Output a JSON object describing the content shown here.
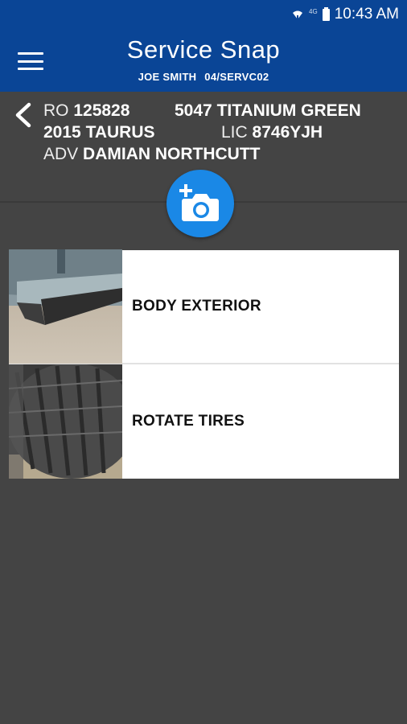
{
  "status_bar": {
    "network_label": "4G",
    "time": "10:43 AM"
  },
  "app_bar": {
    "title": "Service Snap",
    "user": "JOE SMITH",
    "location": "04/SERVC02"
  },
  "info": {
    "ro_label": "RO",
    "ro_value": "125828",
    "color_code": "5047",
    "color_name": "TITANIUM GREEN",
    "year": "2015",
    "model": "TAURUS",
    "lic_label": "LIC",
    "lic_value": "8746YJH",
    "adv_label": "ADV",
    "adv_value": "DAMIAN NORTHCUTT"
  },
  "services": [
    {
      "label": "BODY EXTERIOR",
      "thumb_icon": "car-body-photo"
    },
    {
      "label": "ROTATE TIRES",
      "thumb_icon": "tire-photo"
    }
  ],
  "colors": {
    "app_bar": "#0a4596",
    "fab": "#1a88e6",
    "background": "#444444"
  }
}
